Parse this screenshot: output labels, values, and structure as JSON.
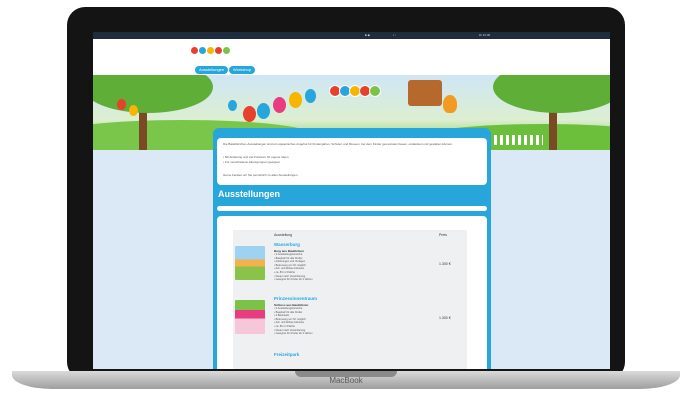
{
  "laptop": {
    "brand": "MacBook"
  },
  "menubar": {
    "left_item": "",
    "mid_item_1": "■ ◆",
    "mid_item_2": "▪ ▫",
    "clock": "Di 10:00"
  },
  "nav": {
    "btn_exhibitions": "Ausstellungen",
    "btn_workshop": "Workshop"
  },
  "intro": {
    "paragraph_1": "Die Bauklötzchen-Ausstellungen sind ein spielerisches Angebot für Kindergärten, Schulen und Museen, bei dem Kinder gemeinsam bauen, entdecken und gestalten können.",
    "bullet_1": "• Mit Anleitung und viel Freiraum für eigene Ideen",
    "bullet_2": "• Für verschiedene Altersgruppen geeignet",
    "paragraph_2": "Gerne beraten wir Sie persönlich zu allen Ausstellungen."
  },
  "section": {
    "title": "Ausstellungen"
  },
  "table": {
    "col_exhibition": "Ausstellung",
    "col_price": "Preis",
    "rows": [
      {
        "title": "Wasserburg",
        "subtitle": "Burg aus Bauklötzen",
        "lines": [
          "• 2 Ausstellungsbereiche",
          "• Bauplatz für alle Kinder",
          "• Anleitungen und Vorlagen",
          "• Betreuung vor Ort möglich",
          "• Auf- und Abbau inklusive",
          "• ca. 80 m² Fläche",
          "• Dauer nach Vereinbarung",
          "• Geeignet für Kinder ab 3 Jahren"
        ],
        "price": "1.300 €"
      },
      {
        "title": "Prinzessinnentraum",
        "subtitle": "Schloss aus Bauklötzen",
        "lines": [
          "• 2 Ausstellungsbereiche",
          "• Bauplatz für alle Kinder",
          "• 2 Bauinseln",
          "• Betreuung vor Ort möglich",
          "• Auf- und Abbau inklusive",
          "• ca. 80 m² Fläche",
          "• Dauer nach Vereinbarung",
          "• Geeignet für Kinder ab 3 Jahren"
        ],
        "price": "1.300 €"
      },
      {
        "title": "Freizeitpark",
        "subtitle": "",
        "lines": [],
        "price": ""
      }
    ]
  },
  "colors": {
    "accent": "#27a6dc",
    "menubar": "#1d2d3e",
    "page_bg": "#dbe9f6"
  }
}
